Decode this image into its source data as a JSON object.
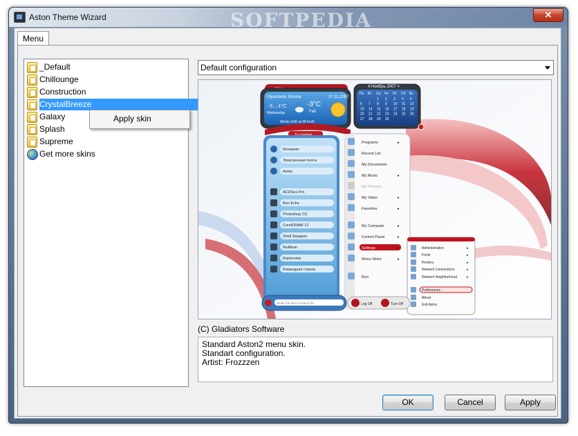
{
  "window": {
    "title": "Aston Theme Wizard",
    "close_glyph": "✕",
    "watermark": "SOFTPEDIA"
  },
  "tabs": [
    {
      "label": "Menu"
    }
  ],
  "skins_list": {
    "items": [
      {
        "label": "_Default",
        "icon": "skin-file-icon"
      },
      {
        "label": "Chillounge",
        "icon": "skin-file-icon"
      },
      {
        "label": "Construction",
        "icon": "skin-file-icon"
      },
      {
        "label": "CrystalBreeze",
        "icon": "skin-file-icon",
        "selected": true
      },
      {
        "label": "Galaxy",
        "icon": "skin-file-icon"
      },
      {
        "label": "Splash",
        "icon": "skin-file-icon"
      },
      {
        "label": "Supreme",
        "icon": "skin-file-icon"
      },
      {
        "label": "Get more skins",
        "icon": "globe-icon"
      }
    ]
  },
  "context_menu": {
    "items": [
      {
        "label": "Apply skin"
      }
    ]
  },
  "configuration": {
    "selected": "Default configuration"
  },
  "preview": {
    "user": "Alex",
    "weather": {
      "city": "Ulyanovsk, Russia",
      "date": "27.11.2007",
      "temp_range": "-5...-1°C",
      "temp_now": "-3°C",
      "condition": "Fair",
      "day": "Wednesday",
      "wind": "Winds SSE at 35 km/h"
    },
    "calendar": {
      "header": "4 Ноябрь 2007 >",
      "weekdays": [
        "Пн",
        "Вт",
        "Ср",
        "Чт",
        "Пт",
        "Сб",
        "Вс"
      ],
      "days": [
        "",
        "",
        "1",
        "2",
        "3",
        "4",
        "5",
        "6",
        "7",
        "8",
        "9",
        "10",
        "11",
        "12",
        "13",
        "14",
        "15",
        "16",
        "17",
        "18",
        "19",
        "20",
        "21",
        "22",
        "23",
        "24",
        "25",
        "26",
        "27",
        "28",
        "29",
        "30",
        "",
        ""
      ]
    },
    "button_label": "Try Firebird",
    "pinned": [
      "Интернет",
      "Электронная почта",
      "Aston"
    ],
    "recent": [
      "ACDSee Pro",
      "Bon Echo",
      "Photoshop CS",
      "CorelDRAW 12",
      "Shell Swapper",
      "Multitran",
      "Rainlendar",
      "Командная строка"
    ],
    "menu": [
      "Programs",
      "Recent List",
      "My Documents",
      "My Music",
      "My Pictures",
      "My Video",
      "Favorites",
      "My Computer",
      "Control Panel",
      "Settings",
      "Menu Skins",
      "Run"
    ],
    "submenu": [
      "Administration",
      "Fonts",
      "Printers",
      "Network Connections",
      "Network Neighborhood",
      "Preferences",
      "About",
      "Exit Aston"
    ],
    "search_placeholder": "Enter the text to search for",
    "log_off": "Log Off",
    "turn_off": "Turn Off"
  },
  "author": "(C) Gladiators Software",
  "description": [
    "Standard Aston2 menu skin.",
    "Standart configuration.",
    "Artist: Frozzzen"
  ],
  "buttons": {
    "ok": "OK",
    "cancel": "Cancel",
    "apply": "Apply"
  }
}
